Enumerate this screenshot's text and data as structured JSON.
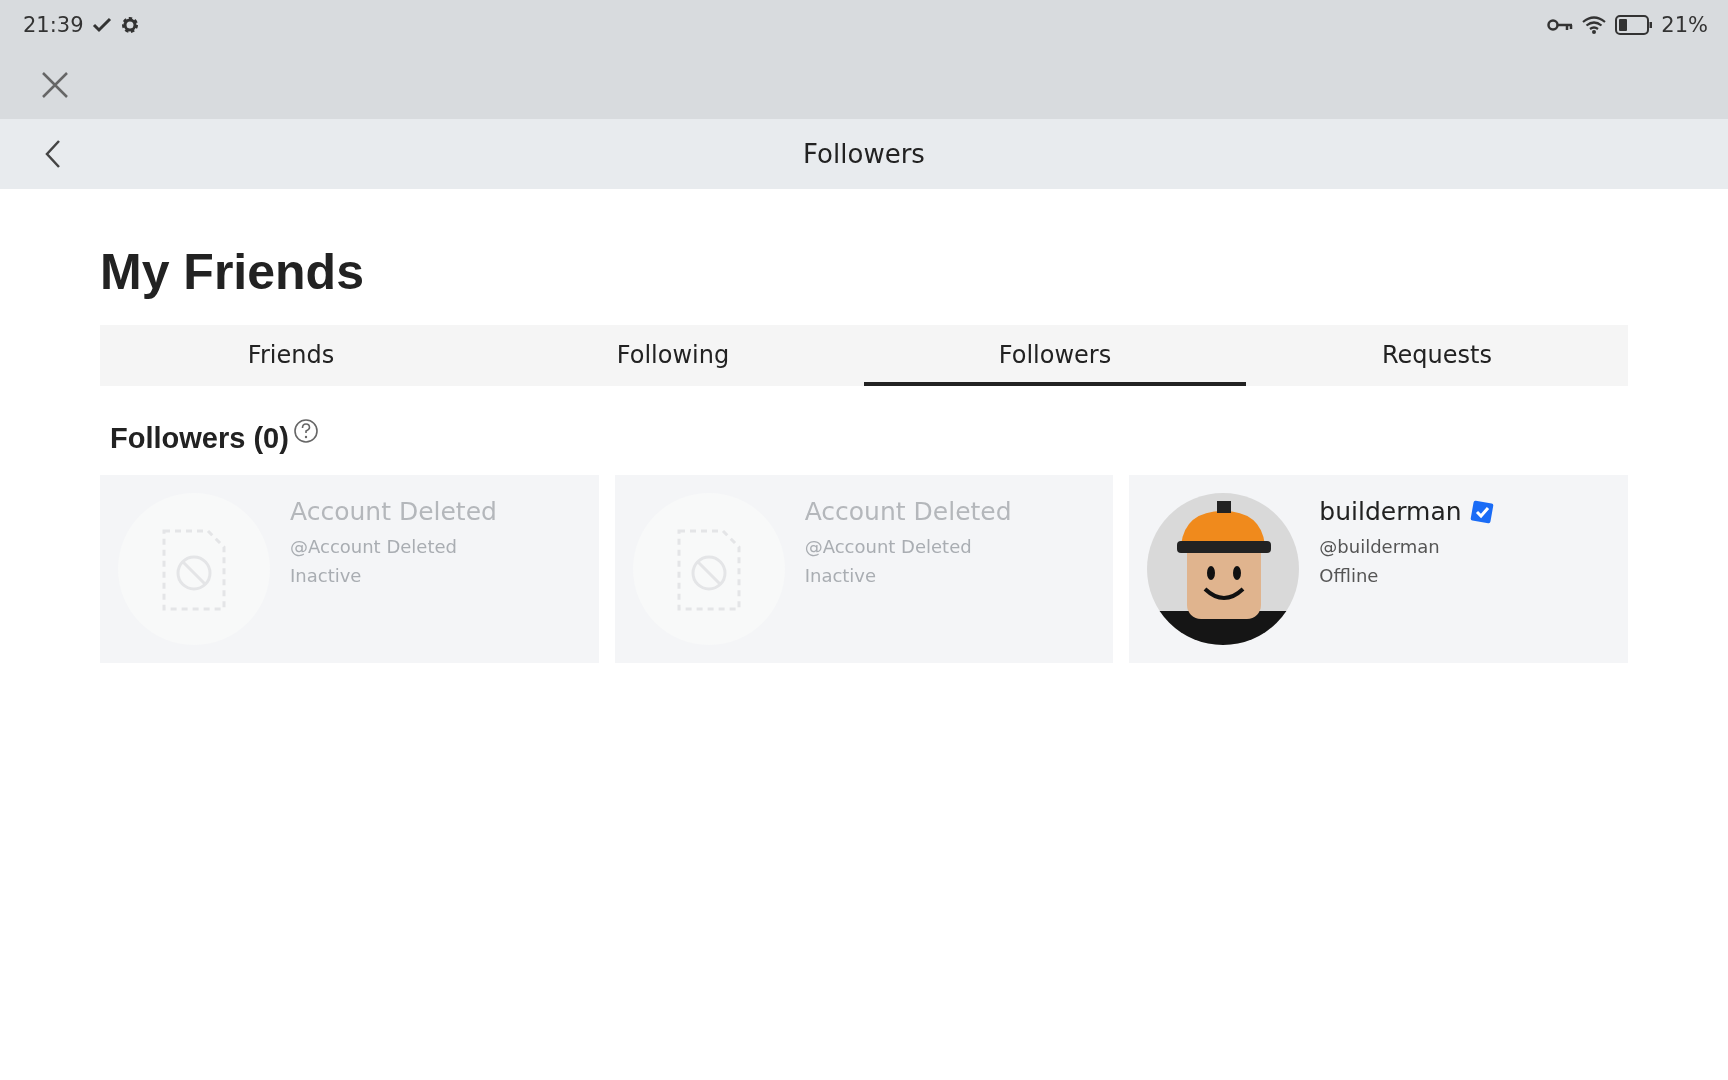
{
  "status_bar": {
    "time": "21:39",
    "battery": "21%"
  },
  "header": {
    "title": "Followers"
  },
  "page": {
    "title": "My Friends"
  },
  "tabs": [
    {
      "label": "Friends",
      "selected": false
    },
    {
      "label": "Following",
      "selected": false
    },
    {
      "label": "Followers",
      "selected": true
    },
    {
      "label": "Requests",
      "selected": false
    }
  ],
  "section": {
    "title": "Followers (0)"
  },
  "cards": [
    {
      "kind": "deleted",
      "name": "Account Deleted",
      "handle": "@Account Deleted",
      "status": "Inactive",
      "verified": false
    },
    {
      "kind": "deleted",
      "name": "Account Deleted",
      "handle": "@Account Deleted",
      "status": "Inactive",
      "verified": false
    },
    {
      "kind": "user",
      "name": "builderman",
      "handle": "@builderman",
      "status": "Offline",
      "verified": true
    }
  ]
}
